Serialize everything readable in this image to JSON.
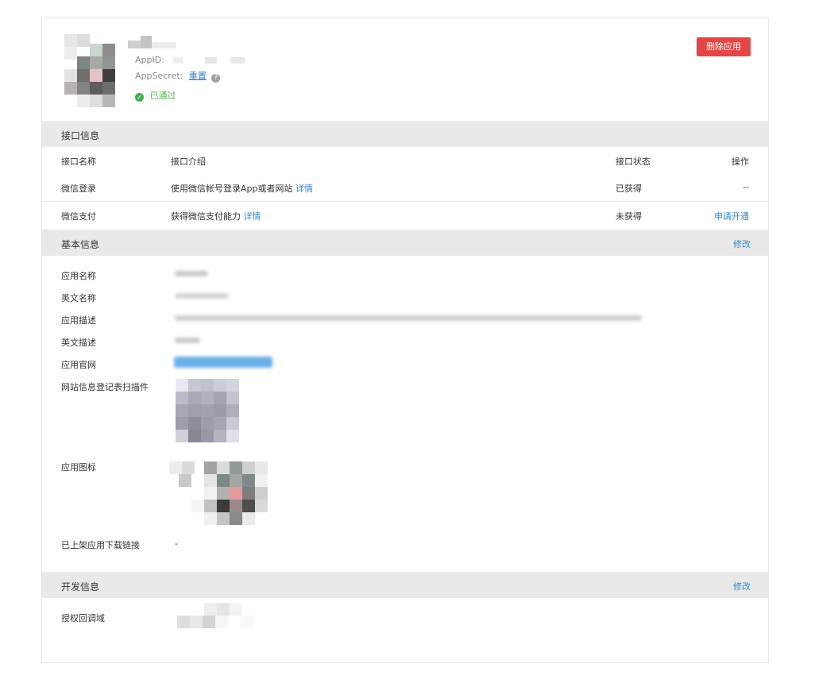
{
  "header": {
    "appid_label": "AppID:",
    "appsecret_label": "AppSecret:",
    "reset_label": "重置",
    "help_glyph": "?",
    "status_icon": "check-circle-icon",
    "status_text": "已通过",
    "delete_button": "删除应用"
  },
  "api": {
    "section_title": "接口信息",
    "columns": [
      "接口名称",
      "接口介绍",
      "接口状态",
      "操作"
    ],
    "rows": [
      {
        "name": "微信登录",
        "desc": "使用微信帐号登录App或者网站",
        "detail": "详情",
        "status": "已获得",
        "action": "--"
      },
      {
        "name": "微信支付",
        "desc": "获得微信支付能力",
        "detail": "详情",
        "status": "未获得",
        "action": "申请开通"
      }
    ]
  },
  "basic": {
    "section_title": "基本信息",
    "edit_label": "修改",
    "labels": {
      "app_name": "应用名称",
      "en_name": "英文名称",
      "app_desc": "应用描述",
      "en_desc": "英文描述",
      "website": "应用官网",
      "site_plugin": "网站信息登记表扫描件",
      "app_icon": "应用图标",
      "download_link": "已上架应用下载链接"
    },
    "download_link_value": "-"
  },
  "dev": {
    "section_title": "开发信息",
    "edit_label": "修改",
    "callback_label": "授权回调域"
  },
  "colors": {
    "accent": "#2f86d6",
    "danger": "#e64545",
    "success": "#52b64d",
    "section_bg": "#e9e9e9"
  }
}
